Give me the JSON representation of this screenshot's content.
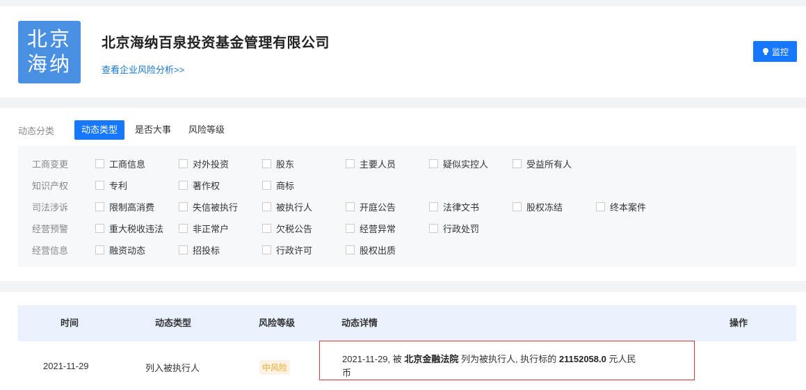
{
  "company": {
    "logo_line1": "北京",
    "logo_line2": "海纳",
    "name": "北京海纳百泉投资基金管理有限公司",
    "risk_link": "查看企业风险分析>>",
    "monitor_label": "监控"
  },
  "filters": {
    "label": "动态分类",
    "tabs": [
      "动态类型",
      "是否大事",
      "风险等级"
    ],
    "active_tab": "动态类型"
  },
  "categories": [
    {
      "label": "工商变更",
      "options": [
        "工商信息",
        "对外投资",
        "股东",
        "主要人员",
        "疑似实控人",
        "受益所有人"
      ]
    },
    {
      "label": "知识产权",
      "options": [
        "专利",
        "著作权",
        "商标"
      ]
    },
    {
      "label": "司法涉诉",
      "options": [
        "限制高消费",
        "失信被执行",
        "被执行人",
        "开庭公告",
        "法律文书",
        "股权冻结",
        "终本案件"
      ]
    },
    {
      "label": "经营预警",
      "options": [
        "重大税收违法",
        "非正常户",
        "欠税公告",
        "经营异常",
        "行政处罚"
      ]
    },
    {
      "label": "经营信息",
      "options": [
        "融资动态",
        "招投标",
        "行政许可",
        "股权出质"
      ]
    }
  ],
  "table": {
    "headers": {
      "time": "时间",
      "type": "动态类型",
      "risk": "风险等级",
      "detail": "动态详情",
      "action": "操作"
    },
    "rows": [
      {
        "time": "2021-11-29",
        "type": "列入被执行人",
        "risk": "中风险",
        "detail_date": "2021-11-29, 被",
        "detail_court": "北京金融法院",
        "detail_mid": "列为被执行人, 执行标的",
        "detail_amount": "21152058.0",
        "detail_unit": "元人民",
        "detail_tail": "币"
      }
    ]
  },
  "colors": {
    "accent": "#1677ff",
    "logo_bg": "#4a90e2",
    "risk_medium": "#f5a623",
    "highlight_border": "#d9363e"
  }
}
